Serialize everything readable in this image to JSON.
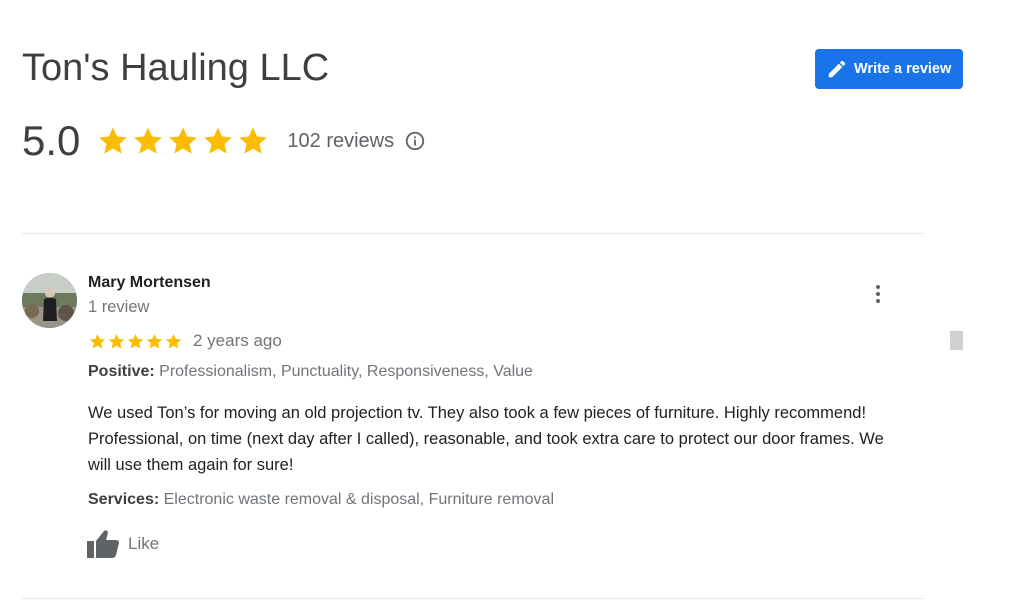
{
  "business": {
    "name": "Ton's Hauling LLC",
    "rating": "5.0",
    "stars": 5,
    "review_count": "102 reviews"
  },
  "write_review": {
    "label": "Write a review",
    "icon": "pencil-icon"
  },
  "icons": {
    "info": "info-icon",
    "more": "more-vert-icon",
    "like": "thumbs-up-icon",
    "star": "star-icon"
  },
  "colors": {
    "accent": "#1a73e8",
    "star": "#fbbc04",
    "muted_text": "#70757a",
    "divider": "#e8eaed"
  },
  "review": {
    "author": "Mary Mortensen",
    "author_meta": "1 review",
    "stars": 5,
    "date": "2 years ago",
    "positive_label": "Positive:",
    "positive_value": "Professionalism, Punctuality, Responsiveness, Value",
    "text": "We used Ton’s for moving an old projection tv. They also took a few pieces of furniture. Highly recommend! Professional, on time (next day after I called), reasonable, and took extra care to protect our door frames. We will use them again for sure!",
    "services_label": "Services:",
    "services_value": "Electronic waste removal & disposal, Furniture removal",
    "like_label": "Like"
  }
}
